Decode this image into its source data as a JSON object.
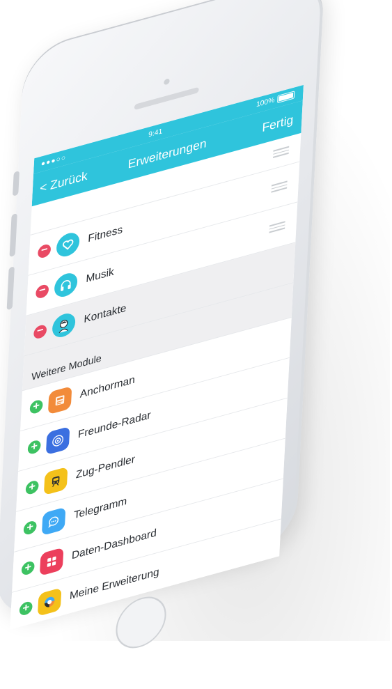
{
  "status_bar": {
    "carrier": "●●●○○",
    "time": "9:41",
    "battery": "100%"
  },
  "nav": {
    "back": "< Zurück",
    "title": "Erweiterungen",
    "done": "Fertig"
  },
  "active_modules": [
    {
      "label": "Fitness",
      "icon": "heart-icon",
      "color": "#2fc4dc"
    },
    {
      "label": "Musik",
      "icon": "headphones-icon",
      "color": "#2fc4dc"
    },
    {
      "label": "Kontakte",
      "icon": "contact-avatar-icon",
      "color": "#2fc4dc"
    }
  ],
  "section_title": "Weitere Module",
  "more_modules": [
    {
      "label": "Anchorman",
      "icon": "newspaper-icon",
      "color": "#f28b3a"
    },
    {
      "label": "Freunde-Radar",
      "icon": "radar-icon",
      "color": "#3b6fe0"
    },
    {
      "label": "Zug-Pendler",
      "icon": "train-icon",
      "color": "#f4c11a"
    },
    {
      "label": "Telegramm",
      "icon": "chat-bubble-icon",
      "color": "#3fa9f5"
    },
    {
      "label": "Daten-Dashboard",
      "icon": "dashboard-grid-icon",
      "color": "#ec3f5c"
    },
    {
      "label": "Meine Erweiterung",
      "icon": "custom-extension-icon",
      "color": "#f4c11a"
    }
  ],
  "colors": {
    "accent": "#2fc4dc",
    "remove": "#e94a64",
    "add": "#3dc262"
  }
}
